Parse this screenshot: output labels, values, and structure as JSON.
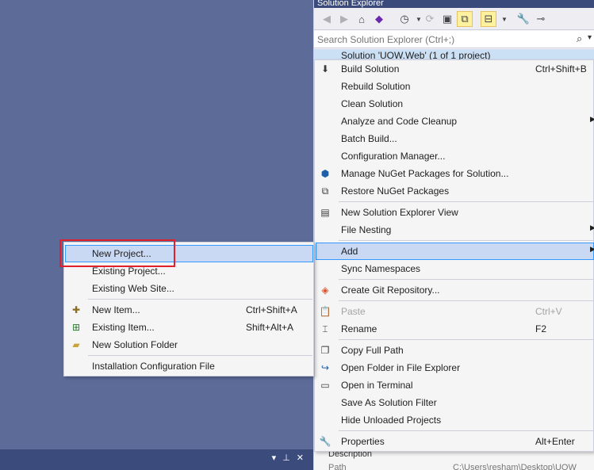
{
  "solution_explorer": {
    "title": "Solution Explorer",
    "search_placeholder": "Search Solution Explorer (Ctrl+;)",
    "tree_root": "Solution 'UOW.Web' (1 of 1 project)",
    "props": {
      "description_label": "Description",
      "path_label": "Path",
      "path_value": "C:\\Users\\resham\\Desktop\\UOW"
    }
  },
  "context_menu": {
    "items": [
      {
        "label": "Build Solution",
        "shortcut": "Ctrl+Shift+B",
        "icon": "build-icon"
      },
      {
        "label": "Rebuild Solution",
        "shortcut": ""
      },
      {
        "label": "Clean Solution",
        "shortcut": ""
      },
      {
        "label": "Analyze and Code Cleanup",
        "shortcut": "",
        "submenu": true
      },
      {
        "label": "Batch Build...",
        "shortcut": ""
      },
      {
        "label": "Configuration Manager...",
        "shortcut": ""
      },
      {
        "label": "Manage NuGet Packages for Solution...",
        "shortcut": "",
        "icon": "nuget-icon"
      },
      {
        "label": "Restore NuGet Packages",
        "shortcut": "",
        "icon": "restore-icon"
      },
      {
        "label": "New Solution Explorer View",
        "shortcut": "",
        "icon": "new-view-icon"
      },
      {
        "label": "File Nesting",
        "shortcut": "",
        "submenu": true
      },
      {
        "label": "Add",
        "shortcut": "",
        "submenu": true,
        "highlighted": true
      },
      {
        "label": "Sync Namespaces",
        "shortcut": ""
      },
      {
        "label": "Create Git Repository...",
        "shortcut": "",
        "icon": "git-icon"
      },
      {
        "label": "Paste",
        "shortcut": "Ctrl+V",
        "disabled": true,
        "icon": "paste-icon"
      },
      {
        "label": "Rename",
        "shortcut": "F2",
        "icon": "rename-icon"
      },
      {
        "label": "Copy Full Path",
        "shortcut": "",
        "icon": "copy-icon"
      },
      {
        "label": "Open Folder in File Explorer",
        "shortcut": "",
        "icon": "open-folder-icon"
      },
      {
        "label": "Open in Terminal",
        "shortcut": "",
        "icon": "terminal-icon"
      },
      {
        "label": "Save As Solution Filter",
        "shortcut": ""
      },
      {
        "label": "Hide Unloaded Projects",
        "shortcut": ""
      },
      {
        "label": "Properties",
        "shortcut": "Alt+Enter",
        "icon": "wrench-icon"
      }
    ]
  },
  "add_submenu": {
    "items": [
      {
        "label": "New Project...",
        "shortcut": "",
        "highlighted": true
      },
      {
        "label": "Existing Project...",
        "shortcut": ""
      },
      {
        "label": "Existing Web Site...",
        "shortcut": ""
      },
      {
        "label": "New Item...",
        "shortcut": "Ctrl+Shift+A",
        "icon": "new-item-icon"
      },
      {
        "label": "Existing Item...",
        "shortcut": "Shift+Alt+A",
        "icon": "existing-item-icon"
      },
      {
        "label": "New Solution Folder",
        "shortcut": "",
        "icon": "folder-icon"
      },
      {
        "label": "Installation Configuration File",
        "shortcut": ""
      }
    ]
  },
  "colors": {
    "accent_highlight": "#c9d8f3",
    "highlight_border": "#3399ff",
    "annotation_red": "#e0202a",
    "background": "#5d6b99"
  }
}
